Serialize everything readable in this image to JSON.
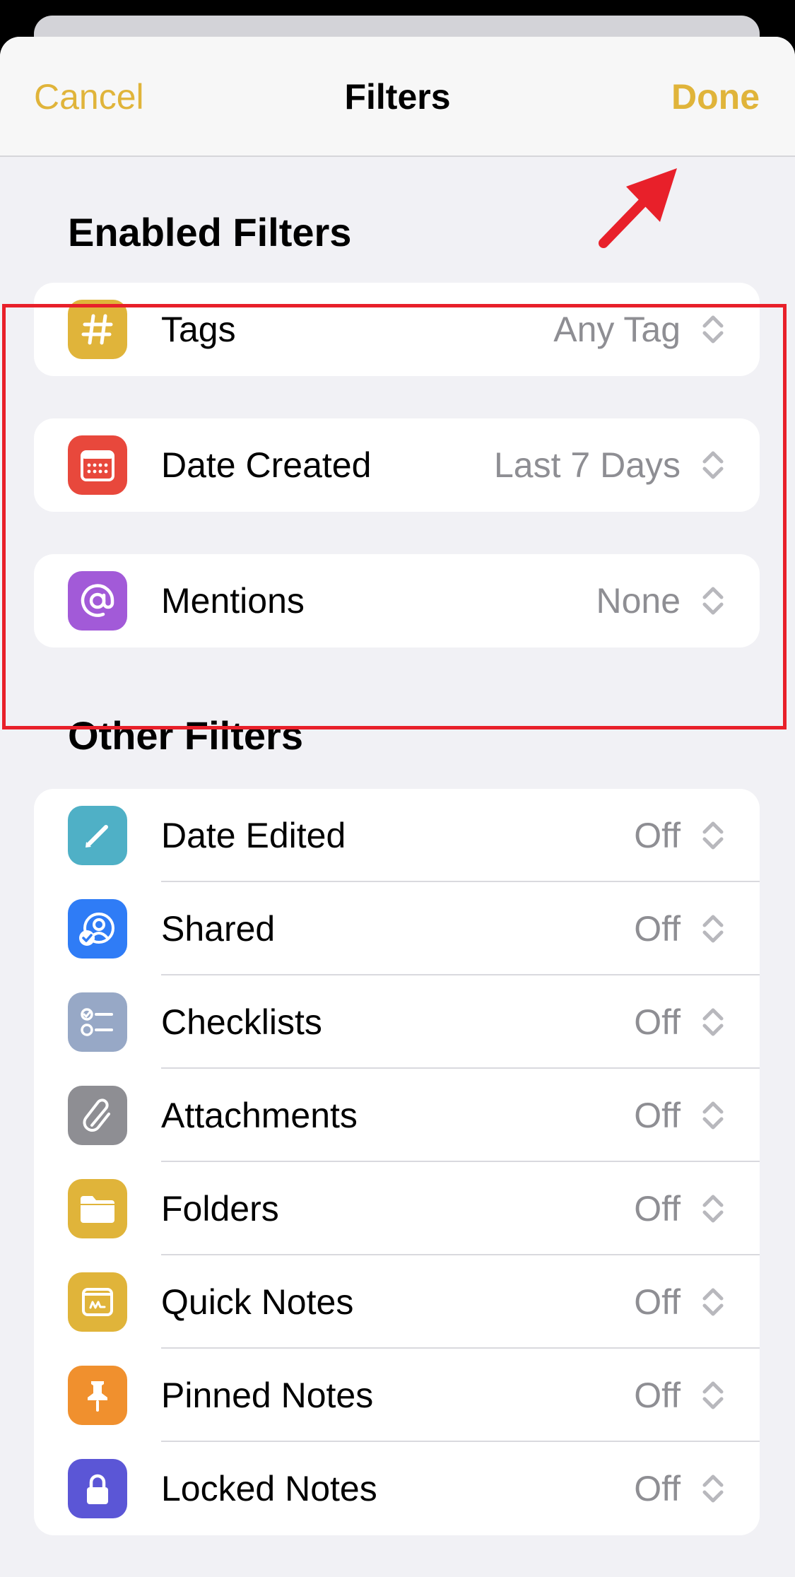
{
  "navbar": {
    "cancel": "Cancel",
    "title": "Filters",
    "done": "Done"
  },
  "enabled": {
    "title": "Enabled Filters",
    "items": [
      {
        "label": "Tags",
        "value": "Any Tag",
        "icon": "hash-icon",
        "color": "#e0b43a"
      },
      {
        "label": "Date Created",
        "value": "Last 7 Days",
        "icon": "calendar-icon",
        "color": "#e8483c"
      },
      {
        "label": "Mentions",
        "value": "None",
        "icon": "at-icon",
        "color": "#a25ad8"
      }
    ]
  },
  "other": {
    "title": "Other Filters",
    "items": [
      {
        "label": "Date Edited",
        "value": "Off",
        "icon": "pencil-icon",
        "color": "#4fb0c6"
      },
      {
        "label": "Shared",
        "value": "Off",
        "icon": "shared-person-icon",
        "color": "#2f7cf6"
      },
      {
        "label": "Checklists",
        "value": "Off",
        "icon": "checklist-icon",
        "color": "#97a8c6"
      },
      {
        "label": "Attachments",
        "value": "Off",
        "icon": "paperclip-icon",
        "color": "#8e8e93"
      },
      {
        "label": "Folders",
        "value": "Off",
        "icon": "folder-icon",
        "color": "#e0b43a"
      },
      {
        "label": "Quick Notes",
        "value": "Off",
        "icon": "quick-note-icon",
        "color": "#e0b43a"
      },
      {
        "label": "Pinned Notes",
        "value": "Off",
        "icon": "pin-icon",
        "color": "#f0902e"
      },
      {
        "label": "Locked Notes",
        "value": "Off",
        "icon": "lock-icon",
        "color": "#5b56d6"
      }
    ]
  },
  "annotations": {
    "highlight_color": "#e8202a",
    "arrow_color": "#e8202a"
  }
}
